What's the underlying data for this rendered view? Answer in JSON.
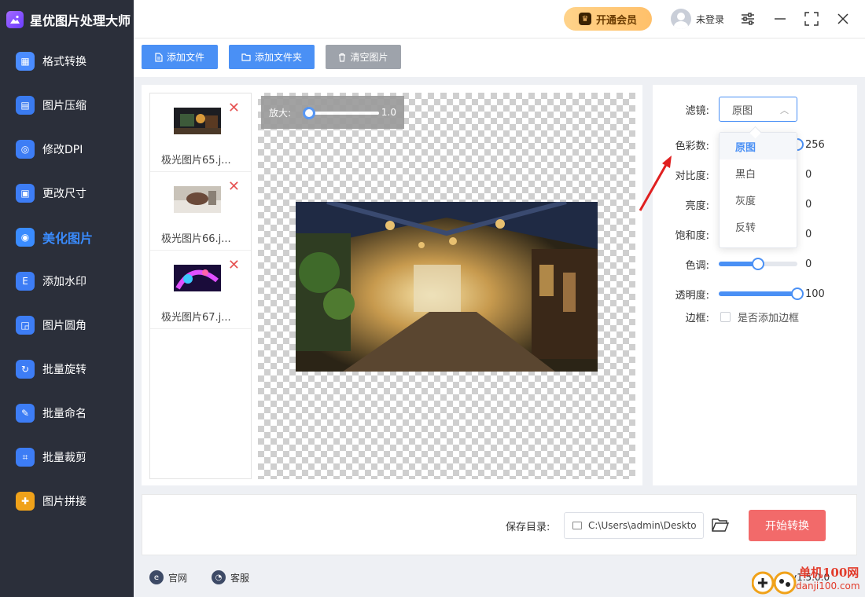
{
  "app": {
    "title": "星优图片处理大师"
  },
  "topbar": {
    "vip_label": "开通会员",
    "user_label": "未登录"
  },
  "sidebar": {
    "items": [
      {
        "label": "格式转换",
        "icon": "image-convert-icon",
        "color": "#4a8cff"
      },
      {
        "label": "图片压缩",
        "icon": "image-compress-icon",
        "color": "#3a7bf0"
      },
      {
        "label": "修改DPI",
        "icon": "dpi-icon",
        "color": "#3d7df5"
      },
      {
        "label": "更改尺寸",
        "icon": "resize-icon",
        "color": "#3d7df5"
      },
      {
        "label": "美化图片",
        "icon": "beautify-icon",
        "color": "#3a8cff"
      },
      {
        "label": "添加水印",
        "icon": "watermark-icon",
        "color": "#3d7df5"
      },
      {
        "label": "图片圆角",
        "icon": "rounded-corner-icon",
        "color": "#3d7df5"
      },
      {
        "label": "批量旋转",
        "icon": "rotate-icon",
        "color": "#3d7df5"
      },
      {
        "label": "批量命名",
        "icon": "rename-icon",
        "color": "#3d7df5"
      },
      {
        "label": "批量裁剪",
        "icon": "crop-icon",
        "color": "#3d7df5"
      },
      {
        "label": "图片拼接",
        "icon": "collage-icon",
        "color": "#f0a21a"
      }
    ],
    "active_index": 4
  },
  "toolbar": {
    "add_file": "添加文件",
    "add_folder": "添加文件夹",
    "clear_images": "清空图片"
  },
  "files": [
    {
      "name": "极光图片65.j..."
    },
    {
      "name": "极光图片66.j..."
    },
    {
      "name": "极光图片67.j..."
    }
  ],
  "zoom": {
    "label": "放大:",
    "value": "1.0",
    "level": 0
  },
  "settings": {
    "filter_label": "滤镜:",
    "filter_value": "原图",
    "filter_options": [
      "原图",
      "黑白",
      "灰度",
      "反转"
    ],
    "color_count": {
      "label": "色彩数:",
      "value": "256",
      "fraction": 1.0
    },
    "contrast": {
      "label": "对比度:",
      "value": "0",
      "fraction": 0.5
    },
    "brightness": {
      "label": "亮度:",
      "value": "0",
      "fraction": 0.5
    },
    "saturation": {
      "label": "饱和度:",
      "value": "0",
      "fraction": 0.5
    },
    "hue": {
      "label": "色调:",
      "value": "0",
      "fraction": 0.5
    },
    "opacity": {
      "label": "透明度:",
      "value": "100",
      "fraction": 1.0
    },
    "border": {
      "label": "边框:",
      "checkbox_label": "是否添加边框",
      "checked": false
    }
  },
  "bottom": {
    "save_dir_label": "保存目录:",
    "save_dir_value": "C:\\Users\\admin\\Deskto",
    "start_label": "开始转换"
  },
  "footer": {
    "website": "官网",
    "support": "客服",
    "version": "v1.5.0.0"
  },
  "watermark": {
    "name": "单机100网",
    "domain": "danji100.com"
  },
  "colors": {
    "accent": "#4a90f5",
    "start_button": "#f26a6a",
    "sidebar_bg": "#2b2f3a",
    "vip": "#ffc06a",
    "delete": "#e65454"
  }
}
